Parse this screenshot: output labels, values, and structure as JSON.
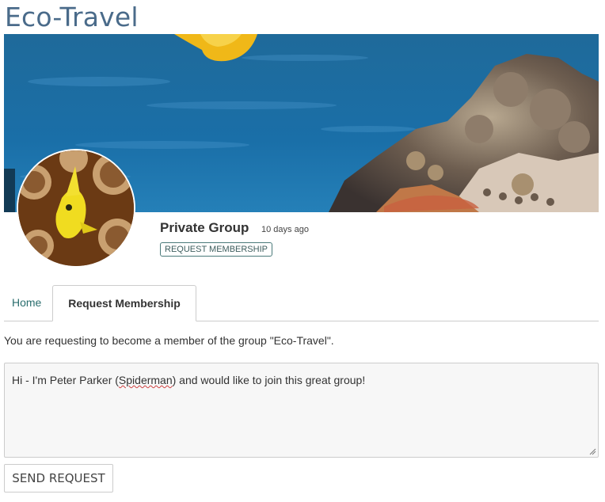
{
  "group": {
    "title": "Eco-Travel",
    "privacy": "Private Group",
    "age": "10 days ago",
    "membership_badge": "REQUEST MEMBERSHIP"
  },
  "images": {
    "cover": "coral-reef-cover-image",
    "avatar": "yellow-fish-avatar-image"
  },
  "tabs": [
    {
      "label": "Home",
      "active": false
    },
    {
      "label": "Request Membership",
      "active": true
    }
  ],
  "request": {
    "intro": "You are requesting to become a member of the group \"Eco-Travel\".",
    "message_before": "Hi - I'm Peter Parker (",
    "message_flagged": "Spiderman",
    "message_after": ") and would like to join this great group!",
    "send_label": "SEND REQUEST"
  },
  "colors": {
    "title": "#4a6b8a",
    "link": "#2a6e6e",
    "spellcheck": "#d04040"
  }
}
